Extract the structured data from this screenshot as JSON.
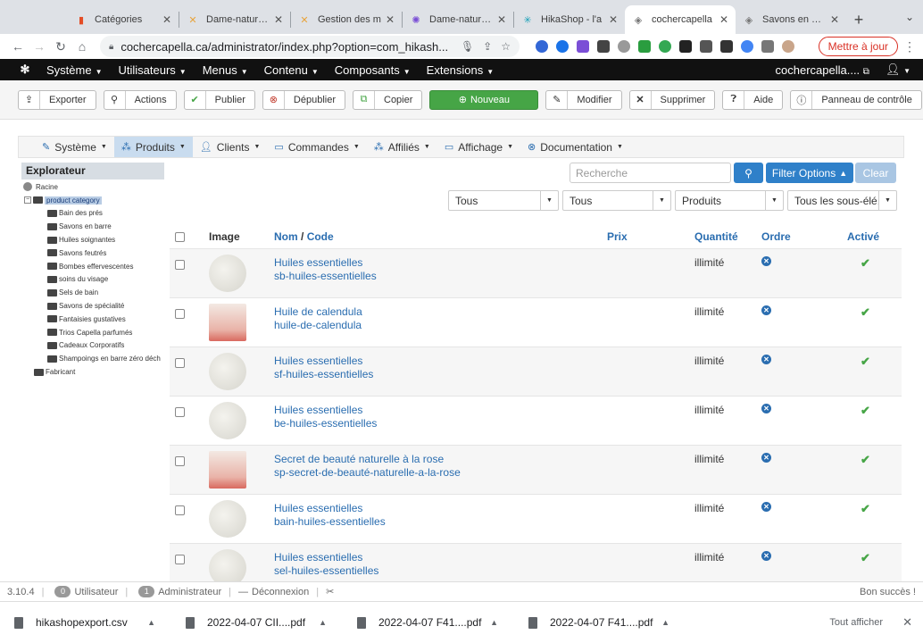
{
  "browser": {
    "tabs": [
      {
        "title": "Catégories",
        "icon": "joomla-icon",
        "active": false
      },
      {
        "title": "Dame-nature.c",
        "icon": "joomla-icon",
        "active": false
      },
      {
        "title": "Gestion des m",
        "icon": "joomla-icon",
        "active": false
      },
      {
        "title": "Dame-nature.c",
        "icon": "star-icon",
        "active": false
      },
      {
        "title": "HikaShop - l'a",
        "icon": "hikashop-icon",
        "active": false
      },
      {
        "title": "cochercapella",
        "icon": "diamond-icon",
        "active": true
      },
      {
        "title": "Savons en barr",
        "icon": "diamond-icon",
        "active": false
      }
    ],
    "url": "cochercapella.ca/administrator/index.php?option=com_hikash...",
    "update_label": "Mettre à jour"
  },
  "joomla_nav": {
    "menus": [
      "Système",
      "Utilisateurs",
      "Menus",
      "Contenu",
      "Composants",
      "Extensions"
    ],
    "site": "cochercapella...."
  },
  "toolbar": {
    "export": "Exporter",
    "actions": "Actions",
    "publish": "Publier",
    "unpublish": "Dépublier",
    "copy": "Copier",
    "new": "Nouveau",
    "edit": "Modifier",
    "delete": "Supprimer",
    "help": "Aide",
    "control_panel": "Panneau de contrôle"
  },
  "hika_nav": {
    "system": "Système",
    "products": "Produits",
    "clients": "Clients",
    "orders": "Commandes",
    "affiliates": "Affiliés",
    "display": "Affichage",
    "docs": "Documentation"
  },
  "explorer": {
    "title": "Explorateur",
    "root": "Racine",
    "category": "product category",
    "children": [
      "Bain des prés",
      "Savons en barre",
      "Huiles soignantes",
      "Savons feutrés",
      "Bombes effervescentes",
      "soins du visage",
      "Sels de bain",
      "Savons de spécialité",
      "Fantaisies gustatives",
      "Trios Capella parfumés",
      "Cadeaux Corporatifs",
      "Shampoings en barre zéro déch"
    ],
    "manufacturer": "Fabricant"
  },
  "filters": {
    "search_placeholder": "Recherche",
    "filter_options": "Filter Options",
    "clear": "Clear",
    "selects": [
      "Tous",
      "Tous",
      "Produits",
      "Tous les sous-élé..."
    ]
  },
  "table": {
    "headers": {
      "image": "Image",
      "name": "Nom",
      "slash": " / ",
      "code": "Code",
      "price": "Prix",
      "quantity": "Quantité",
      "order": "Ordre",
      "active": "Activé"
    },
    "rows": [
      {
        "name": "Huiles essentielles",
        "code": "sb-huiles-essentielles",
        "qty": "illimité",
        "thumb": "round"
      },
      {
        "name": "Huile de calendula",
        "code": "huile-de-calendula",
        "qty": "illimité",
        "thumb": "square"
      },
      {
        "name": "Huiles essentielles",
        "code": "sf-huiles-essentielles",
        "qty": "illimité",
        "thumb": "round"
      },
      {
        "name": "Huiles essentielles",
        "code": "be-huiles-essentielles",
        "qty": "illimité",
        "thumb": "round"
      },
      {
        "name": "Secret de beauté naturelle à la rose",
        "code": "sp-secret-de-beauté-naturelle-a-la-rose",
        "qty": "illimité",
        "thumb": "square"
      },
      {
        "name": "Huiles essentielles",
        "code": "bain-huiles-essentielles",
        "qty": "illimité",
        "thumb": "round"
      },
      {
        "name": "Huiles essentielles",
        "code": "sel-huiles-essentielles",
        "qty": "illimité",
        "thumb": "round"
      }
    ]
  },
  "status": {
    "version": "3.10.4",
    "users_count": "0",
    "users_label": "Utilisateur",
    "admins_count": "1",
    "admins_label": "Administrateur",
    "logout": "Déconnexion",
    "right": "Bon succès !"
  },
  "downloads": {
    "items": [
      "hikashopexport.csv",
      "2022-04-07 CII....pdf",
      "2022-04-07 F41....pdf",
      "2022-04-07 F41....pdf"
    ],
    "show_all": "Tout afficher"
  },
  "colors": {
    "accent": "#2f80c9",
    "success": "#46a546",
    "link": "#2a6db0",
    "topbar": "#111111"
  }
}
